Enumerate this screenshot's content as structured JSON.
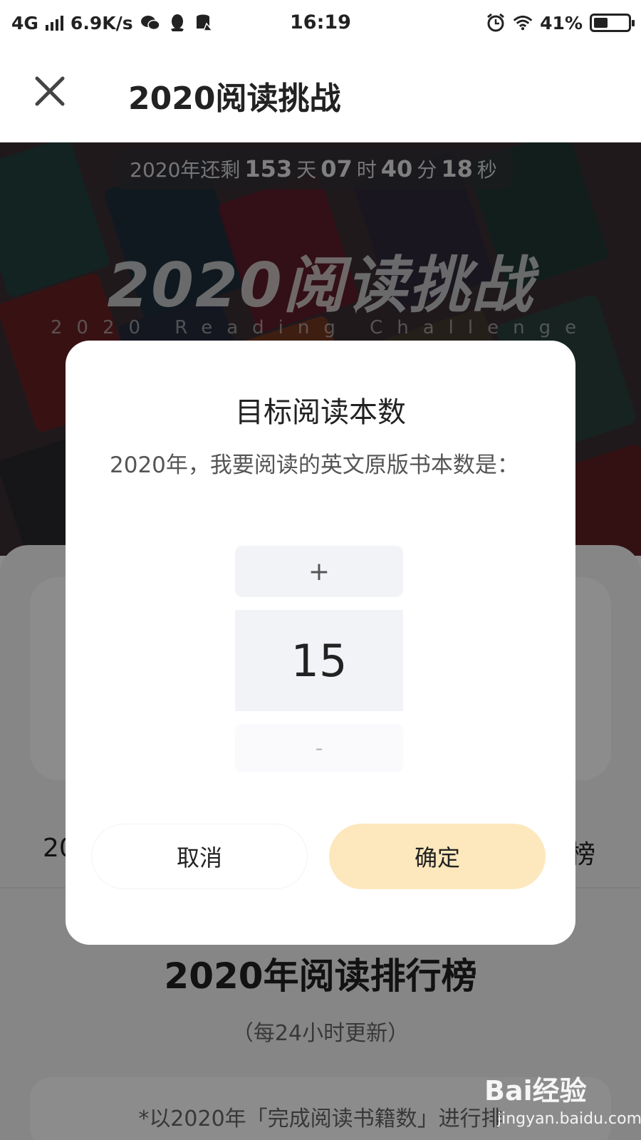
{
  "status_bar": {
    "network": "4G",
    "speed": "6.9K/s",
    "time": "16:19",
    "battery": "41%",
    "battery_level": 0.41
  },
  "header": {
    "title": "2020阅读挑战"
  },
  "hero": {
    "countdown_prefix": "2020年还剩",
    "days": "153",
    "days_unit": "天",
    "hours": "07",
    "hours_unit": "时",
    "minutes": "40",
    "minutes_unit": "分",
    "seconds": "18",
    "seconds_unit": "秒",
    "title": "2020阅读挑战",
    "subtitle": "2020 Reading Challenge"
  },
  "background": {
    "tab_left_fragment": "20",
    "tab_right_fragment": "榜",
    "ranking_title": "2020年阅读排行榜",
    "ranking_subtitle": "（每24小时更新）",
    "ranking_note": "*以2020年「完成阅读书籍数」进行排"
  },
  "modal": {
    "title": "目标阅读本数",
    "description": "2020年，我要阅读的英文原版书本数是：",
    "plus_label": "+",
    "value": "15",
    "minus_label": "-",
    "cancel_label": "取消",
    "confirm_label": "确定"
  },
  "colors": {
    "confirm_bg": "#fde8bd",
    "stepper_bg": "#f2f3f7"
  },
  "watermark": {
    "logo": "Bai经验",
    "url": "jingyan.baidu.com"
  }
}
